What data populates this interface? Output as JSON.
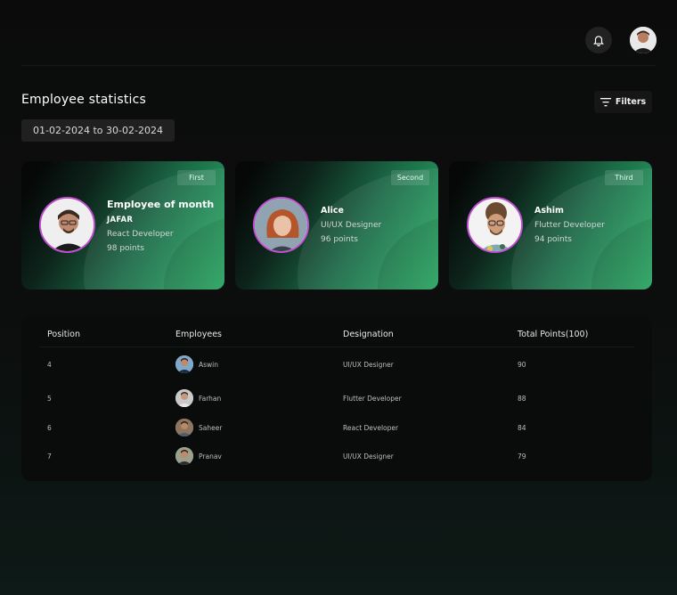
{
  "header": {
    "notification_icon": "bell-icon",
    "avatar_icon": "user-avatar"
  },
  "page": {
    "title": "Employee statistics",
    "date_range": "01-02-2024 to 30-02-2024",
    "filters_label": "Filters"
  },
  "cards": [
    {
      "rank": "First",
      "heading": "Employee of month",
      "name": "JAFAR",
      "role": "React Developer",
      "points": "98 points",
      "accent": "#c04dd0"
    },
    {
      "rank": "Second",
      "name": "Alice",
      "role": "UI/UX Designer",
      "points": "96 points",
      "accent": "#c04dd0"
    },
    {
      "rank": "Third",
      "name": "Ashim",
      "role": "Flutter Developer",
      "points": "94 points",
      "accent": "#c04dd0"
    }
  ],
  "table": {
    "headers": [
      "Position",
      "Employees",
      "Designation",
      "Total Points(100)"
    ],
    "rows": [
      {
        "position": "4",
        "employee": "Aswin",
        "designation": "UI/UX Designer",
        "points": "90"
      },
      {
        "position": "5",
        "employee": "Farhan",
        "designation": "Flutter Developer",
        "points": "88"
      },
      {
        "position": "6",
        "employee": "Saheer",
        "designation": "React Developer",
        "points": "84"
      },
      {
        "position": "7",
        "employee": "Pranav",
        "designation": "UI/UX Designer",
        "points": "79"
      }
    ]
  },
  "colors": {
    "background": "#0b0b0b",
    "card_green": "#2db36a",
    "avatar_ring": "#c04dd0"
  }
}
